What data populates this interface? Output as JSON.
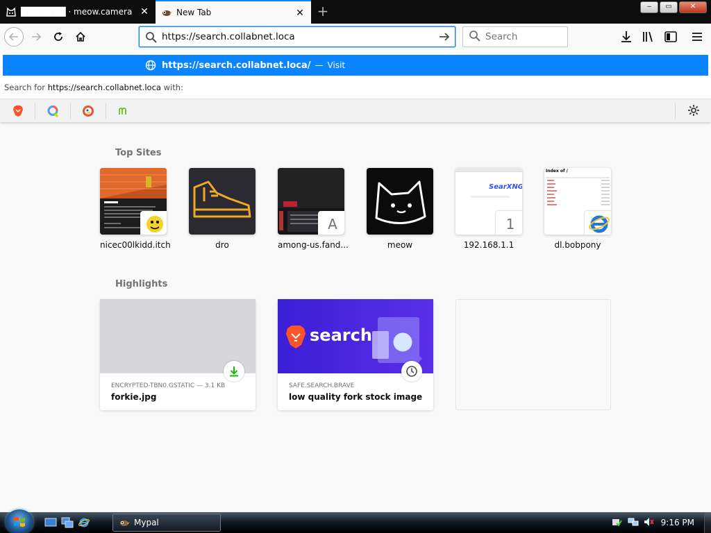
{
  "tabs": [
    {
      "title": "███████ · meow.camera",
      "active": false
    },
    {
      "title": "New Tab",
      "active": true
    }
  ],
  "window_buttons": {
    "minimize": "‒",
    "maximize": "▭",
    "close": "✕"
  },
  "new_tab_glyph": "+",
  "navbar": {
    "url_value": "https://search.collabnet.loca",
    "search_placeholder": "Search"
  },
  "dropdown": {
    "result_url": "https://search.collabnet.loca/",
    "result_sep": "—",
    "result_action": "Visit",
    "search_for_prefix": "Search for",
    "search_for_query": "https://search.collabnet.loca",
    "search_for_suffix": "with:",
    "engines": [
      "brave-search",
      "qwant",
      "duckduckgo",
      "mojeek"
    ]
  },
  "top_sites_title": "Top Sites",
  "top_sites": [
    {
      "label": "nicec00lkidd.itch",
      "badge": ""
    },
    {
      "label": "dro",
      "badge": ""
    },
    {
      "label": "among-us.fand...",
      "badge": "A"
    },
    {
      "label": "meow",
      "badge": ""
    },
    {
      "label": "192.168.1.1",
      "badge": "1"
    },
    {
      "label": "dl.bobpony",
      "badge": ""
    }
  ],
  "highlights_title": "Highlights",
  "highlights": [
    {
      "source": "ENCRYPTED-TBN0.GSTATIC — 3.1 KB",
      "title": "forkie.jpg",
      "icon": "download-icon"
    },
    {
      "source": "SAFE.SEARCH.BRAVE",
      "title": "low quality fork stock image - Br...",
      "icon": "clock-icon",
      "image_text": "search"
    }
  ],
  "searxng_thumb_text": "SearXNG",
  "index_thumb_text": "Index of /",
  "taskbar": {
    "window_label": "Mypal",
    "clock": "9:16 PM"
  },
  "colors": {
    "accent": "#0a84ff",
    "brave": "#fb542b",
    "taskbar": "#0e1620"
  }
}
